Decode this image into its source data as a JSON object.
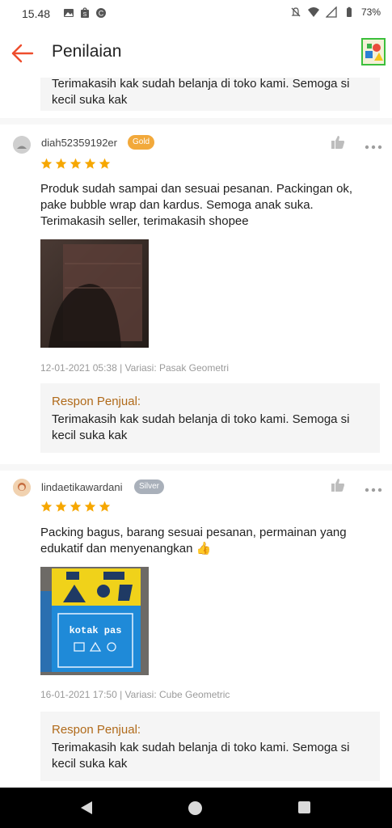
{
  "status_bar": {
    "time": "15.48",
    "battery": "73%"
  },
  "app_bar": {
    "title": "Penilaian"
  },
  "colors": {
    "accent": "#ee4d2d",
    "reply_label": "#b06a1a",
    "gold_badge": "#f2a93b",
    "silver_badge": "#a9b0ba",
    "star": "#f6a700"
  },
  "top_reply": {
    "text": "Terimakasih kak sudah belanja di toko kami. Semoga si kecil suka kak"
  },
  "reviews": [
    {
      "username": "diah52359192er",
      "badge": "Gold",
      "rating": 5,
      "comment": "Produk sudah sampai dan sesuai pesanan. Packingan ok, pake bubble wrap dan kardus. Semoga anak suka. Terimakasih seller, terimakasih shopee",
      "meta": "12-01-2021 05:38 | Variasi: Pasak Geometri",
      "reply_label": "Respon Penjual:",
      "reply_text": "Terimakasih kak sudah belanja di toko kami. Semoga si kecil suka kak"
    },
    {
      "username": "lindaetikawardani",
      "badge": "Silver",
      "rating": 5,
      "comment": "Packing bagus, barang sesuai pesanan, permainan yang edukatif dan menyenangkan 👍",
      "photo_text": "kotak pas",
      "meta": "16-01-2021 17:50 | Variasi: Cube Geometric",
      "reply_label": "Respon Penjual:",
      "reply_text": "Terimakasih kak sudah belanja di toko kami. Semoga si kecil suka kak"
    }
  ]
}
